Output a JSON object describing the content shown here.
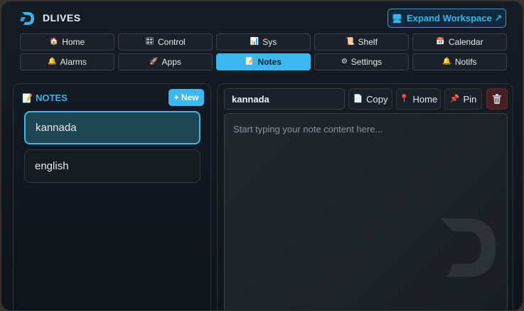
{
  "app": {
    "brand": "DLIVES"
  },
  "header": {
    "expand_label": "Expand Workspace ↗"
  },
  "nav": {
    "row1": [
      {
        "label": "Home",
        "icon": "🏠"
      },
      {
        "label": "Control",
        "icon": "🎛"
      },
      {
        "label": "Sys",
        "icon": "📊"
      },
      {
        "label": "Shelf",
        "icon": "📜"
      },
      {
        "label": "Calendar",
        "icon": "📅"
      }
    ],
    "row2": [
      {
        "label": "Alarms",
        "icon": "🔔"
      },
      {
        "label": "Apps",
        "icon": "🚀"
      },
      {
        "label": "Notes",
        "icon": "📝"
      },
      {
        "label": "Settings",
        "icon": "⚙"
      },
      {
        "label": "Notifs",
        "icon": "🔔"
      }
    ],
    "active": "Notes"
  },
  "notes_panel": {
    "title": "NOTES",
    "new_label": "+ New",
    "items": [
      {
        "label": "kannada",
        "active": true
      },
      {
        "label": "english",
        "active": false
      }
    ]
  },
  "editor": {
    "title_value": "kannada",
    "copy_label": "Copy",
    "home_label": "Home",
    "pin_label": "Pin",
    "placeholder": "Start typing your note content here..."
  },
  "colors": {
    "accent": "#3cb8ef",
    "background": "#11161d",
    "delete": "#4a1f23"
  }
}
